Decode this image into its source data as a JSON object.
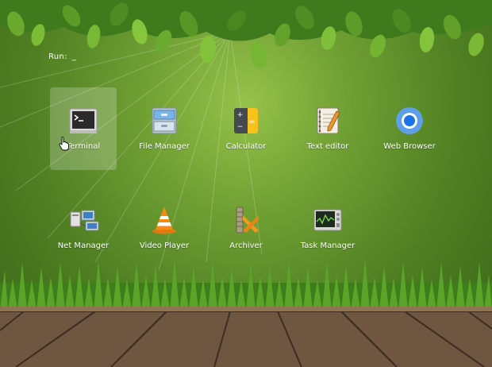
{
  "run": {
    "label": "Run:",
    "cursor": "_"
  },
  "apps": [
    {
      "label": "Terminal",
      "icon": "terminal-icon",
      "selected": true
    },
    {
      "label": "File Manager",
      "icon": "file-cabinet-icon"
    },
    {
      "label": "Calculator",
      "icon": "calculator-icon"
    },
    {
      "label": "Text editor",
      "icon": "notepad-icon"
    },
    {
      "label": "Web Browser",
      "icon": "chromium-icon"
    },
    {
      "label": "Net Manager",
      "icon": "network-computers-icon"
    },
    {
      "label": "Video Player",
      "icon": "vlc-cone-icon"
    },
    {
      "label": "Archiver",
      "icon": "archive-clamp-icon"
    },
    {
      "label": "Task Manager",
      "icon": "system-monitor-icon"
    }
  ],
  "colors": {
    "accent": "#ffffff",
    "wallpaper": "#6f9f33",
    "browser_blue": "#1a73e8",
    "vlc_orange": "#f28c13",
    "calculator_yellow": "#f6c21c"
  }
}
